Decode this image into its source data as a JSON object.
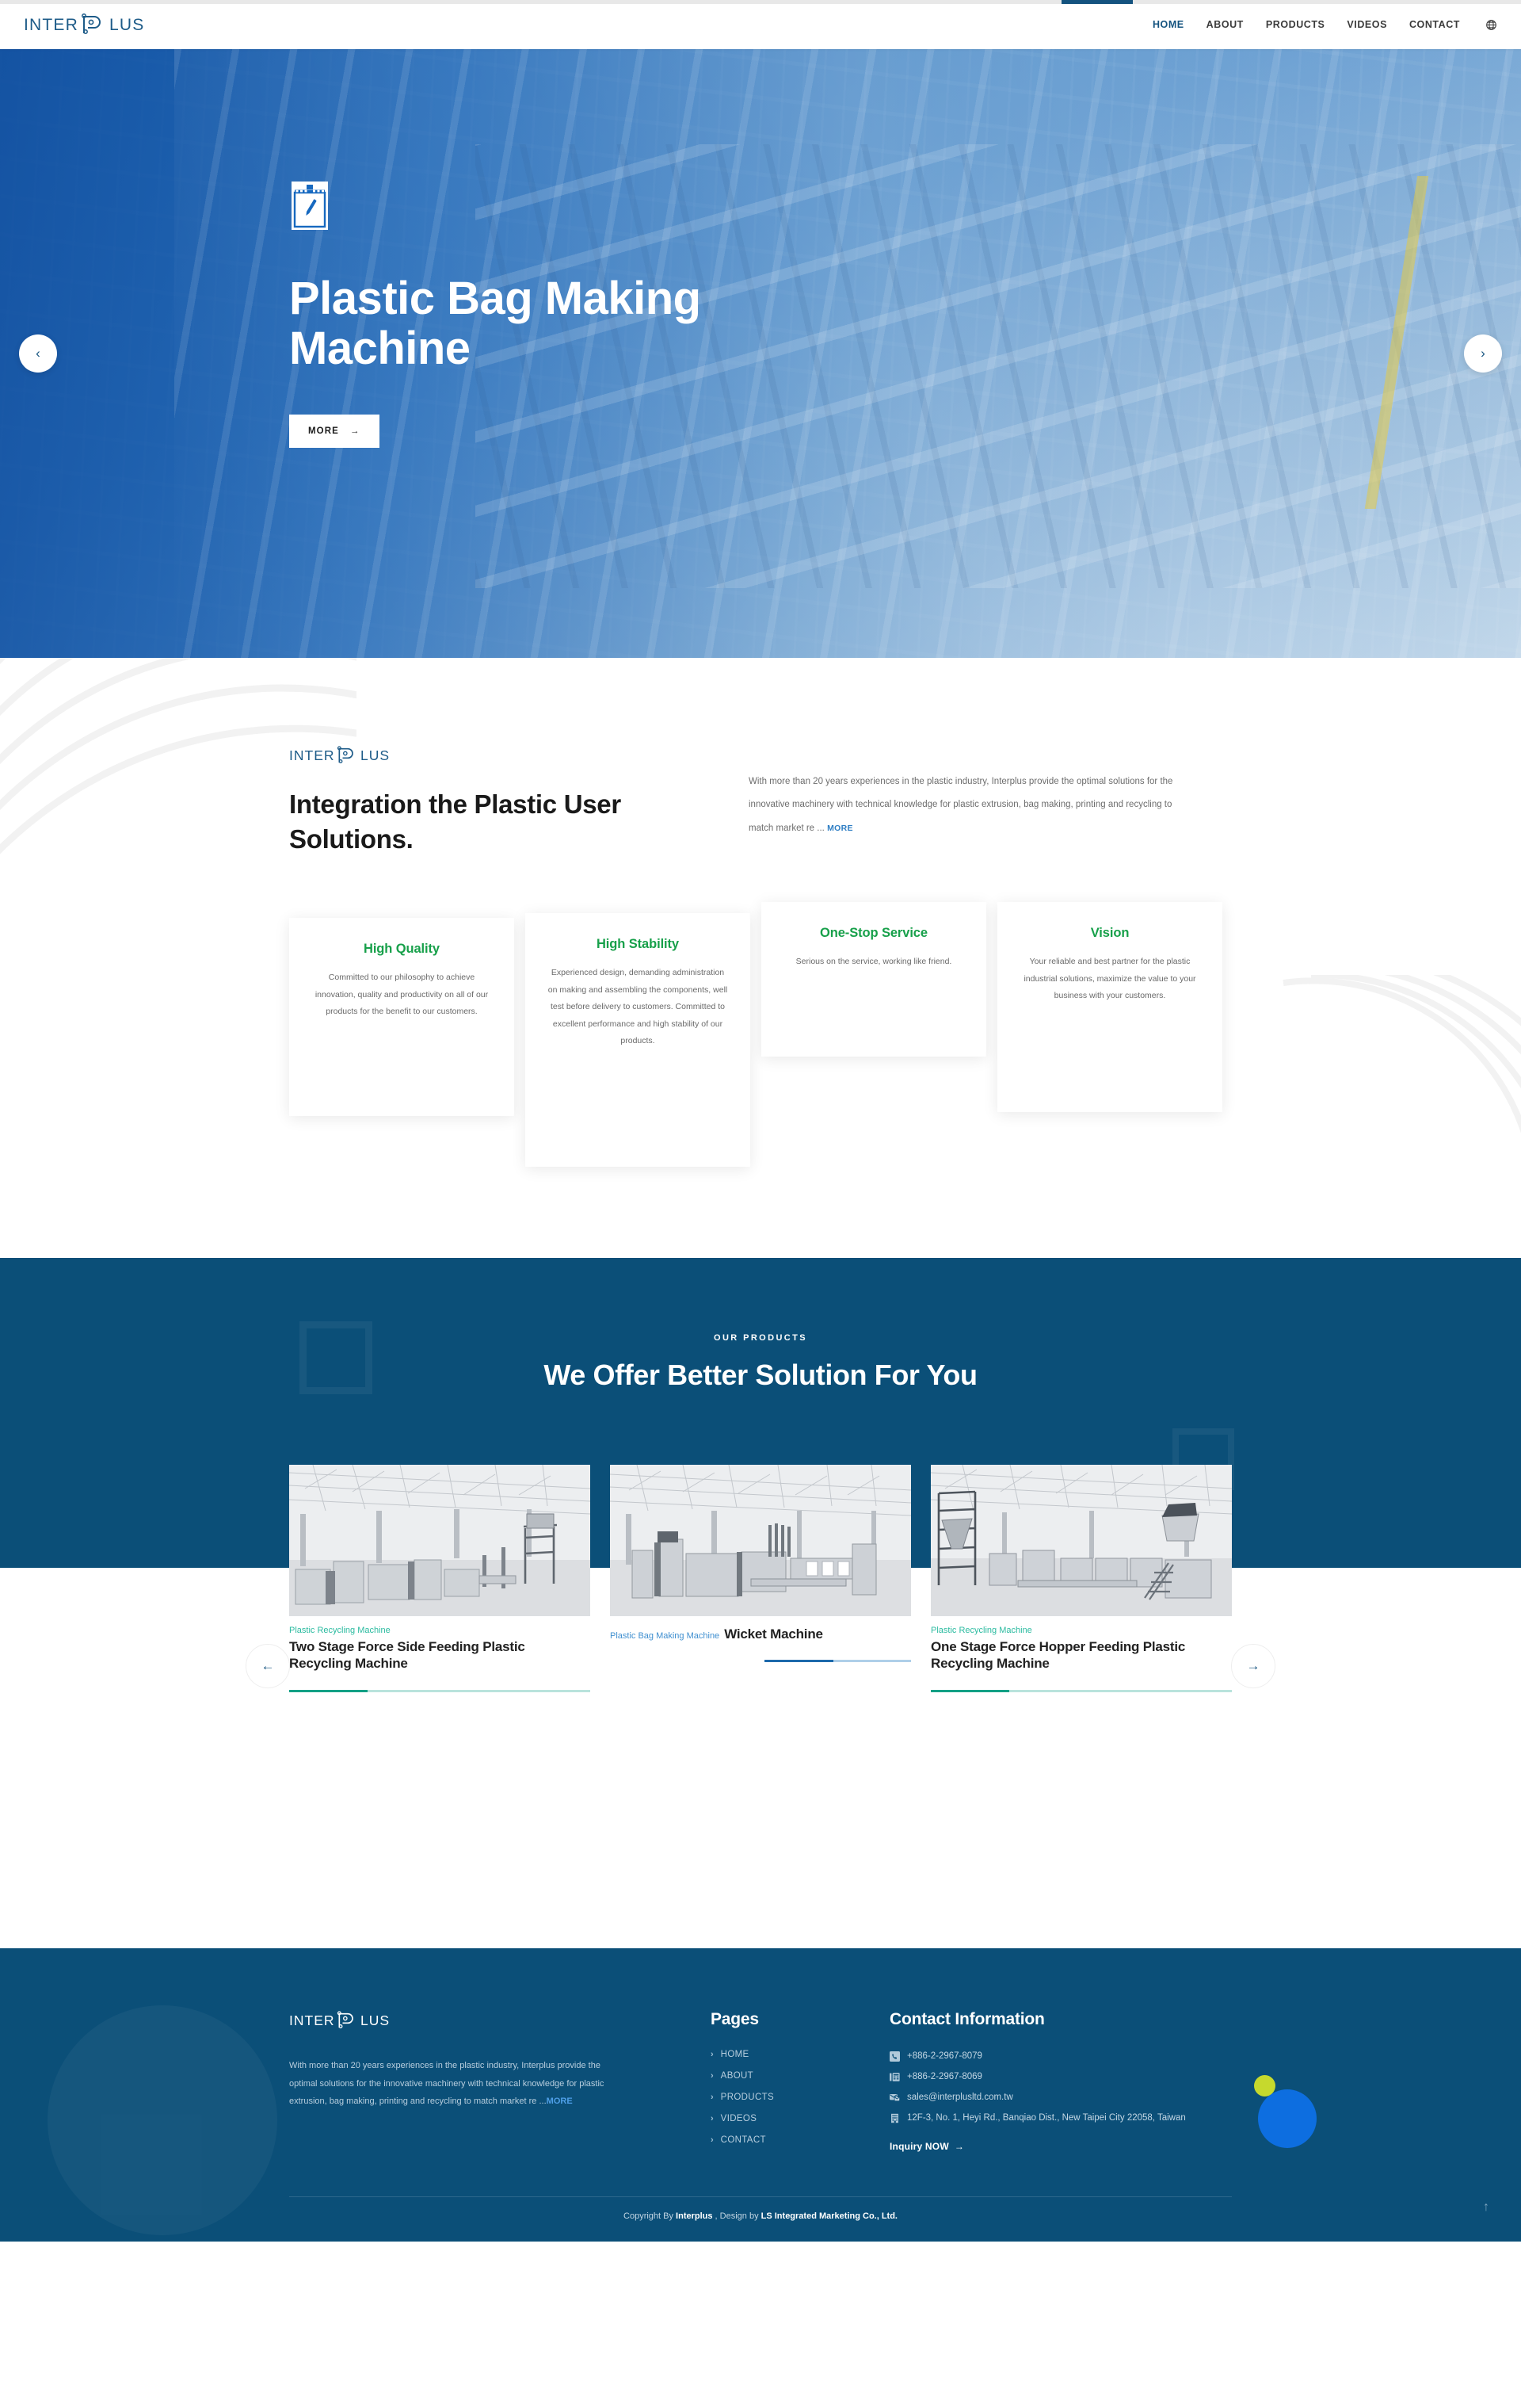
{
  "header": {
    "logo_text": "INTERPLUS",
    "nav": [
      {
        "label": "HOME",
        "active": true
      },
      {
        "label": "ABOUT",
        "active": false
      },
      {
        "label": "PRODUCTS",
        "active": false
      },
      {
        "label": "VIDEOS",
        "active": false
      },
      {
        "label": "CONTACT",
        "active": false
      }
    ],
    "language_icon": "globe-icon"
  },
  "hero": {
    "icon": "plastic-bag-icon",
    "title": "Plastic Bag Making Machine",
    "cta_label": "MORE",
    "cta_arrow": "→",
    "prev_label": "‹",
    "next_label": "›"
  },
  "about": {
    "logo_text": "INTERPLUS",
    "heading": "Integration the Plastic User Solutions.",
    "paragraph": "With more than 20 years experiences in the plastic industry, Interplus provide the optimal solutions for the innovative machinery with technical knowledge for plastic extrusion, bag making, printing and recycling to match market re ... ",
    "more_label": "MORE",
    "cards": [
      {
        "title": "High Quality",
        "text": "Committed to our philosophy to achieve innovation, quality and productivity on all of our products for the benefit to our customers."
      },
      {
        "title": "High Stability",
        "text": "Experienced design, demanding administration on making and assembling the components, well test before delivery to customers. Committed to excellent performance and high stability of our products."
      },
      {
        "title": "One-Stop Service",
        "text": "Serious on the service, working like friend."
      },
      {
        "title": "Vision",
        "text": "Your reliable and best partner for the plastic industrial solutions, maximize the value to your business with your customers."
      }
    ]
  },
  "products": {
    "kicker": "OUR PRODUCTS",
    "title": "We Offer Better Solution For You",
    "prev_label": "←",
    "next_label": "→",
    "items": [
      {
        "category": "Plastic Recycling Machine",
        "name": "Two Stage Force Side Feeding Plastic Recycling Machine",
        "image": "recycling-machine-photo"
      },
      {
        "category": "Plastic Bag Making Machine",
        "name": "Wicket Machine",
        "image": "wicket-machine-photo"
      },
      {
        "category": "Plastic Recycling Machine",
        "name": "One Stage Force Hopper Feeding Plastic Recycling Machine",
        "image": "hopper-feeding-machine-photo"
      }
    ]
  },
  "footer": {
    "logo_text": "INTERPLUS",
    "description": "With more than 20 years experiences in the plastic industry, Interplus provide the optimal solutions for the innovative machinery with technical knowledge for plastic extrusion, bag making, printing and recycling to match market re ...",
    "more_label": "MORE",
    "pages_heading": "Pages",
    "pages": [
      "HOME",
      "ABOUT",
      "PRODUCTS",
      "VIDEOS",
      "CONTACT"
    ],
    "contact_heading": "Contact Information",
    "contact": [
      {
        "icon": "phone-icon",
        "value": "+886-2-2967-8079"
      },
      {
        "icon": "fax-icon",
        "value": "+886-2-2967-8069"
      },
      {
        "icon": "mail-icon",
        "value": "sales@interplusltd.com.tw"
      },
      {
        "icon": "building-icon",
        "value": "12F-3, No. 1, Heyi Rd., Banqiao Dist., New Taipei City 22058, Taiwan"
      }
    ],
    "inquiry_label": "Inquiry NOW",
    "inquiry_arrow": "→",
    "copyright_prefix": "Copyright By ",
    "copyright_company": "Interplus",
    "copyright_mid": " , Design by ",
    "copyright_designer": "LS Integrated Marketing Co., Ltd.",
    "to_top_label": "↑"
  },
  "colors": {
    "brand_dark_blue": "#0b4f78",
    "brand_blue": "#14537f",
    "accent_green": "#17a04a",
    "teal": "#2bbba0",
    "link_blue": "#2e7ec4",
    "circle_blue": "#0d6ee0",
    "circle_yellow": "#c6d92d"
  }
}
